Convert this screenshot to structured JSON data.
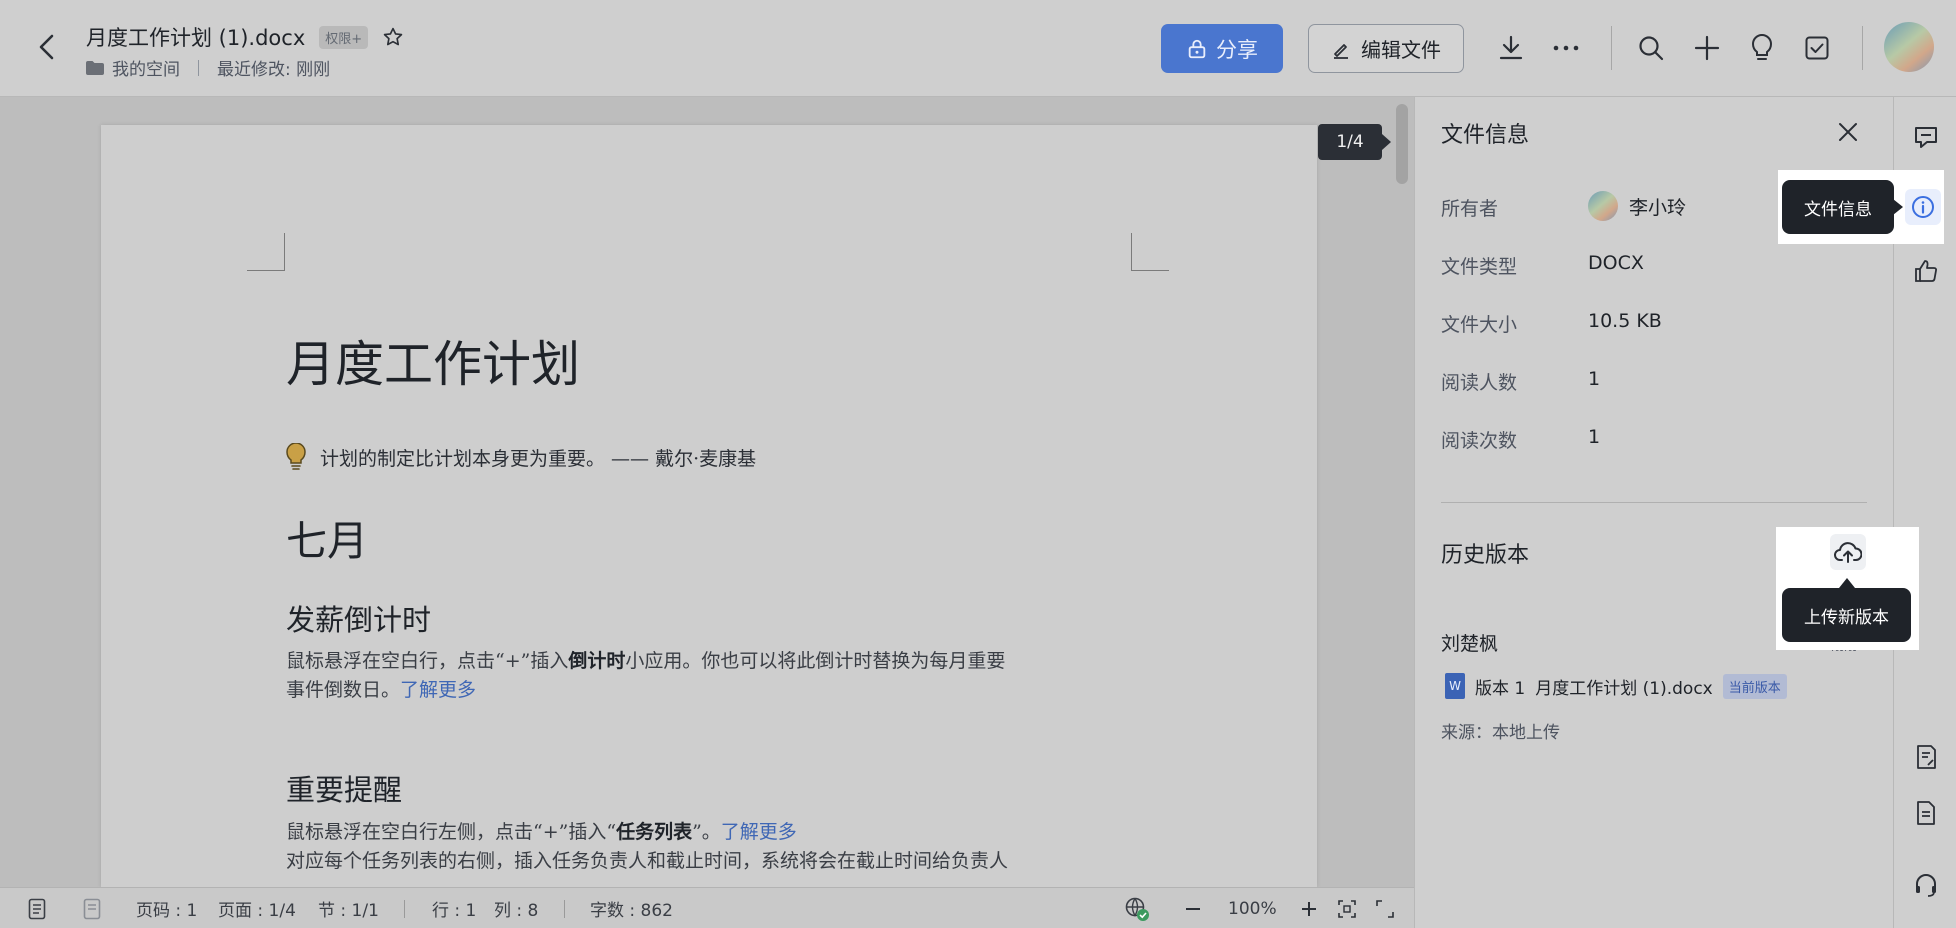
{
  "header": {
    "doc_title": "月度工作计划 (1).docx",
    "permission_badge": "权限+",
    "location": "我的空间",
    "last_modified": "最近修改: 刚刚",
    "share_label": "分享",
    "edit_label": "编辑文件"
  },
  "document": {
    "page_indicator": "1/4",
    "title": "月度工作计划",
    "quote": "计划的制定比计划本身更为重要。 —— 戴尔·麦康基",
    "month_heading": "七月",
    "sections": [
      {
        "heading": "发薪倒计时",
        "p1_a": "鼠标悬浮在空白行，点击“+”插入",
        "p1_b": "倒计时",
        "p1_c": "小应用。你也可以将此倒计时替换为每月重要",
        "p2": "事件倒数日。",
        "link": "了解更多"
      },
      {
        "heading": "重要提醒",
        "p1_a": "鼠标悬浮在空白行左侧，点击“+”插入“",
        "p1_b": "任务列表",
        "p1_c": "”。",
        "link": "了解更多",
        "p2": "对应每个任务列表的右侧，插入任务负责人和截止时间，系统将会在截止时间给负责人"
      }
    ]
  },
  "status_bar": {
    "page_code": "页码 : 1",
    "page": "页面 : 1/4",
    "section": "节 : 1/1",
    "row": "行 : 1",
    "col": "列 : 8",
    "word_count": "字数 : 862",
    "zoom": "100%"
  },
  "panel": {
    "title": "文件信息",
    "owner_label": "所有者",
    "owner_value": "李小玲",
    "type_label": "文件类型",
    "type_value": "DOCX",
    "size_label": "文件大小",
    "size_value": "10.5 KB",
    "readers_label": "阅读人数",
    "readers_value": "1",
    "reads_label": "阅读次数",
    "reads_value": "1",
    "history_title": "历史版本",
    "history_author": "刘楚枫",
    "history_time": "刚刚",
    "version_label": "版本 1",
    "version_file": "月度工作计划 (1).docx",
    "current_badge": "当前版本",
    "source": "来源：本地上传"
  },
  "tooltips": {
    "file_info": "文件信息",
    "upload_new_version": "上传新版本"
  }
}
